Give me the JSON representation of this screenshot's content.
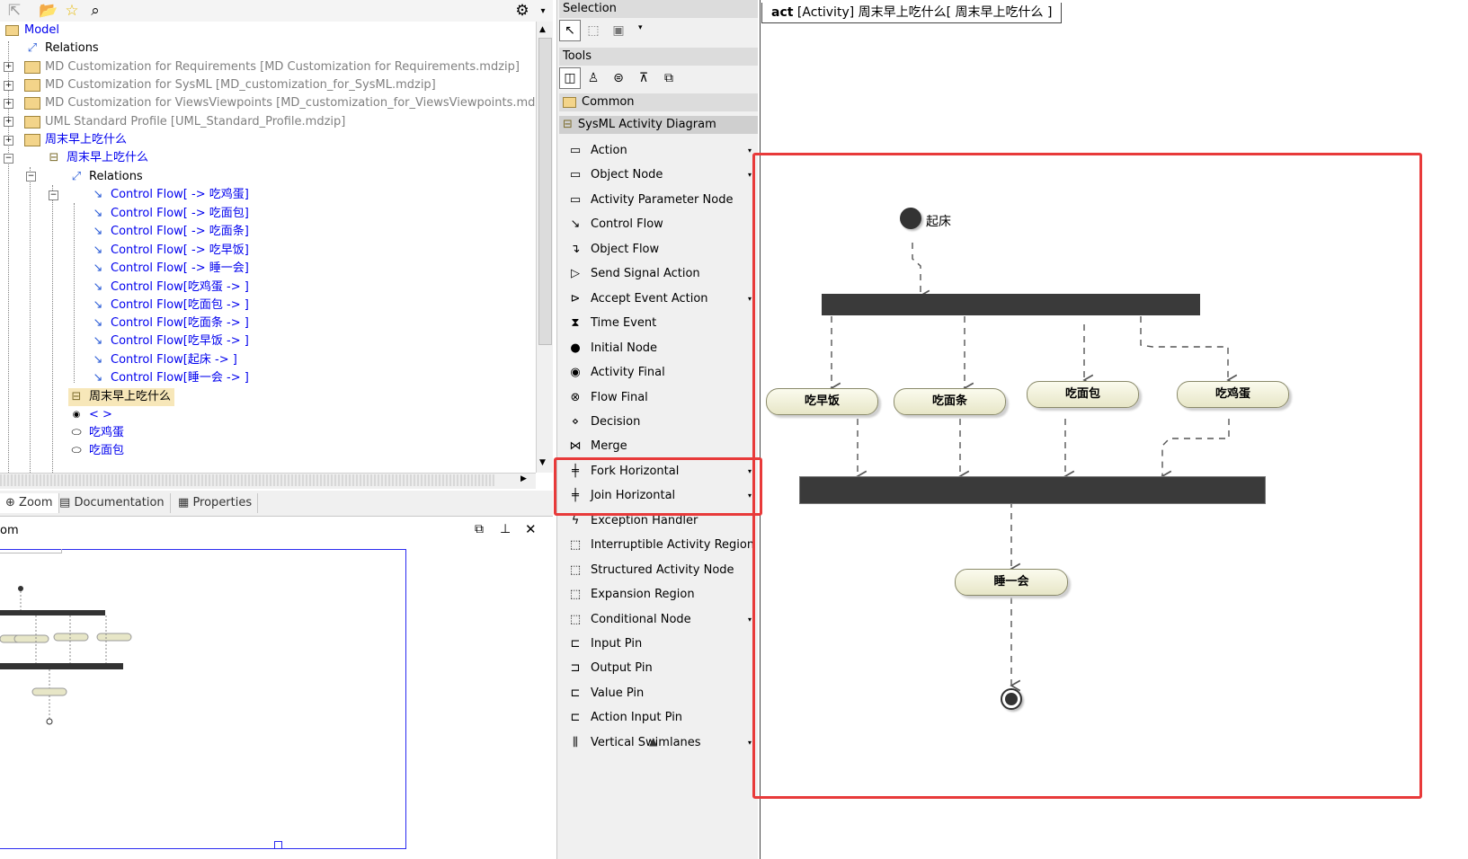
{
  "browser": {
    "tree": [
      {
        "label": "Model",
        "style": "blue"
      },
      {
        "label": "Relations",
        "style": "black"
      },
      {
        "label": "MD Customization for Requirements [MD Customization for Requirements.mdzip]",
        "style": "grey"
      },
      {
        "label": "MD Customization for SysML [MD_customization_for_SysML.mdzip]",
        "style": "grey"
      },
      {
        "label": "MD Customization for ViewsViewpoints [MD_customization_for_ViewsViewpoints.mdzip]",
        "style": "grey"
      },
      {
        "label": "UML Standard Profile [UML_Standard_Profile.mdzip]",
        "style": "grey"
      },
      {
        "label": "周末早上吃什么",
        "style": "blue"
      },
      {
        "label": "周末早上吃什么",
        "style": "blue"
      },
      {
        "label": "Relations",
        "style": "black"
      },
      {
        "label": "Control Flow[ -> 吃鸡蛋]",
        "style": "blue"
      },
      {
        "label": "Control Flow[ -> 吃面包]",
        "style": "blue"
      },
      {
        "label": "Control Flow[ -> 吃面条]",
        "style": "blue"
      },
      {
        "label": "Control Flow[ -> 吃早饭]",
        "style": "blue"
      },
      {
        "label": "Control Flow[ -> 睡一会]",
        "style": "blue"
      },
      {
        "label": "Control Flow[吃鸡蛋 -> ]",
        "style": "blue"
      },
      {
        "label": "Control Flow[吃面包 -> ]",
        "style": "blue"
      },
      {
        "label": "Control Flow[吃面条 -> ]",
        "style": "blue"
      },
      {
        "label": "Control Flow[吃早饭 -> ]",
        "style": "blue"
      },
      {
        "label": "Control Flow[起床 -> ]",
        "style": "blue"
      },
      {
        "label": "Control Flow[睡一会 -> ]",
        "style": "blue"
      },
      {
        "label": "周末早上吃什么",
        "style": "selected"
      },
      {
        "label": "< >",
        "style": "blue"
      },
      {
        "label": "吃鸡蛋",
        "style": "blue"
      },
      {
        "label": "吃面包",
        "style": "blue"
      }
    ],
    "tabs": [
      "Zoom",
      "Documentation",
      "Properties"
    ],
    "zoom_title": "om"
  },
  "palette": {
    "selection_header": "Selection",
    "tools_header": "Tools",
    "groups": [
      "Common",
      "SysML Activity Diagram"
    ],
    "items": [
      {
        "label": "Action",
        "icon": "action-icon",
        "glyph": "▭",
        "arrow": true
      },
      {
        "label": "Object Node",
        "icon": "object-node-icon",
        "glyph": "▭",
        "arrow": true
      },
      {
        "label": "Activity Parameter Node",
        "icon": "activity-parameter-node-icon",
        "glyph": "▭",
        "arrow": false
      },
      {
        "label": "Control Flow",
        "icon": "control-flow-icon",
        "glyph": "↘",
        "arrow": false
      },
      {
        "label": "Object Flow",
        "icon": "object-flow-icon",
        "glyph": "↴",
        "arrow": false
      },
      {
        "label": "Send Signal Action",
        "icon": "send-signal-icon",
        "glyph": "▷",
        "arrow": false
      },
      {
        "label": "Accept Event Action",
        "icon": "accept-event-icon",
        "glyph": "⊳",
        "arrow": true
      },
      {
        "label": "Time Event",
        "icon": "time-event-icon",
        "glyph": "⧗",
        "arrow": false
      },
      {
        "label": "Initial Node",
        "icon": "initial-node-icon",
        "glyph": "●",
        "arrow": false
      },
      {
        "label": "Activity Final",
        "icon": "activity-final-icon",
        "glyph": "◉",
        "arrow": false
      },
      {
        "label": "Flow Final",
        "icon": "flow-final-icon",
        "glyph": "⊗",
        "arrow": false
      },
      {
        "label": "Decision",
        "icon": "decision-icon",
        "glyph": "⋄",
        "arrow": false
      },
      {
        "label": "Merge",
        "icon": "merge-icon",
        "glyph": "⋈",
        "arrow": false
      },
      {
        "label": "Fork Horizontal",
        "icon": "fork-horizontal-icon",
        "glyph": "╪",
        "arrow": true
      },
      {
        "label": "Join Horizontal",
        "icon": "join-horizontal-icon",
        "glyph": "╪",
        "arrow": true
      },
      {
        "label": "Exception Handler",
        "icon": "exception-handler-icon",
        "glyph": "ϟ",
        "arrow": false
      },
      {
        "label": "Interruptible Activity Region",
        "icon": "interruptible-region-icon",
        "glyph": "⬚",
        "arrow": false
      },
      {
        "label": "Structured Activity Node",
        "icon": "structured-node-icon",
        "glyph": "⬚",
        "arrow": false
      },
      {
        "label": "Expansion Region",
        "icon": "expansion-region-icon",
        "glyph": "⬚",
        "arrow": false
      },
      {
        "label": "Conditional Node",
        "icon": "conditional-node-icon",
        "glyph": "⬚",
        "arrow": true
      },
      {
        "label": "Input Pin",
        "icon": "input-pin-icon",
        "glyph": "⊏",
        "arrow": false
      },
      {
        "label": "Output Pin",
        "icon": "output-pin-icon",
        "glyph": "⊐",
        "arrow": false
      },
      {
        "label": "Value Pin",
        "icon": "value-pin-icon",
        "glyph": "⊏",
        "arrow": false
      },
      {
        "label": "Action Input Pin",
        "icon": "action-input-pin-icon",
        "glyph": "⊏",
        "arrow": false
      },
      {
        "label": "Vertical Swimlanes",
        "icon": "vertical-swimlanes-icon",
        "glyph": "⫼",
        "arrow": true
      }
    ]
  },
  "diagram": {
    "frame_kind": "act",
    "frame_title": "[Activity] 周末早上吃什么[ 周末早上吃什么 ]",
    "initial_label": "起床",
    "actions": [
      "吃早饭",
      "吃面条",
      "吃面包",
      "吃鸡蛋",
      "睡一会"
    ]
  },
  "colors": {
    "highlight": "#e83a3a",
    "link_blue": "#0000ee",
    "bar": "#3a3a3a",
    "node_fill": "#f4f3dc"
  }
}
